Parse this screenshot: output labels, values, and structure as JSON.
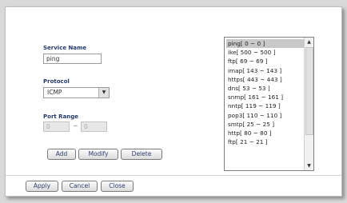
{
  "form": {
    "service_name_label": "Service Name",
    "service_name_value": "ping",
    "protocol_label": "Protocol",
    "protocol_value": "ICMP",
    "port_range_label": "Port Range",
    "port_from_value": "0",
    "port_separator": "~",
    "port_to_value": "0"
  },
  "actions": {
    "add_label": "Add",
    "modify_label": "Modify",
    "delete_label": "Delete"
  },
  "footer": {
    "apply_label": "Apply",
    "cancel_label": "Cancel",
    "close_label": "Close"
  },
  "services": {
    "items": [
      "ping[ 0 ~ 0 ]",
      "ike[ 500 ~ 500 ]",
      "ftp[ 69 ~ 69 ]",
      "imap[ 143 ~ 143 ]",
      "https[ 443 ~ 443 ]",
      "dns[ 53 ~ 53 ]",
      "snmp[ 161 ~ 161 ]",
      "nntp[ 119 ~ 119 ]",
      "pop3[ 110 ~ 110 ]",
      "smtp[ 25 ~ 25 ]",
      "http[ 80 ~ 80 ]",
      "ftp[ 21 ~ 21 ]"
    ],
    "selected_index": 0
  },
  "icons": {
    "dropdown": "chevron-down-icon",
    "scroll_up": "scroll-up-icon",
    "scroll_down": "scroll-down-icon"
  },
  "colors": {
    "label": "#223a6b",
    "selected_item": "#c8c8c8"
  }
}
